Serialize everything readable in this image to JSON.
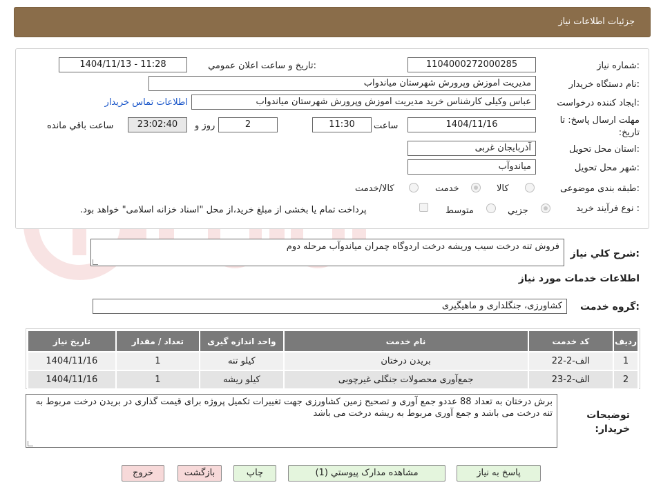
{
  "header": {
    "title": "جزئیات اطلاعات نیاز"
  },
  "form": {
    "need_number": {
      "label": "شماره نیاز:",
      "value": "1104000272000285"
    },
    "announce_datetime": {
      "label": "تاریخ و ساعت اعلان عمومي:",
      "value": "1404/11/13 - 11:28"
    },
    "buyer_org": {
      "label": "نام دستگاه خريدار:",
      "value": "مديريت اموزش وپرورش شهرستان مياندواب"
    },
    "requester": {
      "label": "ايجاد کننده درخواست:",
      "value": "عباس وکيلی کارشناس خريد مديريت اموزش وپرورش شهرستان مياندواب",
      "contact_link": "اطلاعات تماس خريدار"
    },
    "deadline": {
      "label": "مهلت ارسال پاسخ: تا تاریخ:",
      "date": "1404/11/16",
      "time_label": "ساعت",
      "time": "11:30",
      "days": "2",
      "days_label": "روز و",
      "remaining": "23:02:40",
      "remaining_label": "ساعت باقي مانده"
    },
    "province": {
      "label": "استان محل تحويل:",
      "value": "آذربايجان غربی"
    },
    "city": {
      "label": "شهر محل تحويل:",
      "value": "مياندوآب"
    },
    "category": {
      "label": "طبقه بندی موضوعی:",
      "options": [
        "کالا",
        "خدمت",
        "کالا/خدمت"
      ],
      "selected": "خدمت"
    },
    "purchase_type": {
      "label": "نوع فرآیند خرید :",
      "options": [
        "جزيي",
        "متوسط"
      ],
      "selected": "جزيي",
      "treasury_note": "پرداخت تمام يا بخشی از مبلغ خريد،از محل \"اسناد خزانه اسلامی\" خواهد بود."
    }
  },
  "summary": {
    "label": "شرح کلي نياز:",
    "value": "فروش تنه درخت سيب وريشه درخت  اردوگاه چمران مياندوآب مرحله دوم"
  },
  "services_section": {
    "title": "اطلاعات خدمات مورد نياز"
  },
  "service_group": {
    "label": "گروه خدمت:",
    "value": "کشاورزی، جنگلداری و ماهيگيری"
  },
  "table": {
    "headers": [
      "رديف",
      "کد خدمت",
      "نام خدمت",
      "واحد اندازه گيری",
      "تعداد / مقدار",
      "تاريخ نياز"
    ],
    "rows": [
      [
        "1",
        "الف-2-22",
        "بريدن درختان",
        "کيلو تنه",
        "1",
        "1404/11/16"
      ],
      [
        "2",
        "الف-2-23",
        "جمع‌آوری محصولات جنگلی غيرچوبی",
        "کيلو ريشه",
        "1",
        "1404/11/16"
      ]
    ]
  },
  "buyer_notes": {
    "label": "توضيحات خريدار:",
    "value": "برش درختان به تعداد 88 عددو جمع آوری و تصحيح زمين کشاورزی جهت تغييرات تکميل  پروژه برای قيمت گذاری در بريدن درخت مربوط به تنه درخت می باشد و جمع آوری مربوط به ريشه درخت می باشد"
  },
  "buttons": {
    "reply": "پاسخ به نياز",
    "docs": "مشاهده مدارک پيوستي (1)",
    "print": "چاپ",
    "back": "بازگشت",
    "exit": "خروج"
  },
  "colors": {
    "header_bg": "#8a6d4a",
    "table_header_bg": "#7a7a7a",
    "button_green": "#e4f5dd",
    "button_red": "#f7d9d9",
    "link": "#1a56c9"
  }
}
